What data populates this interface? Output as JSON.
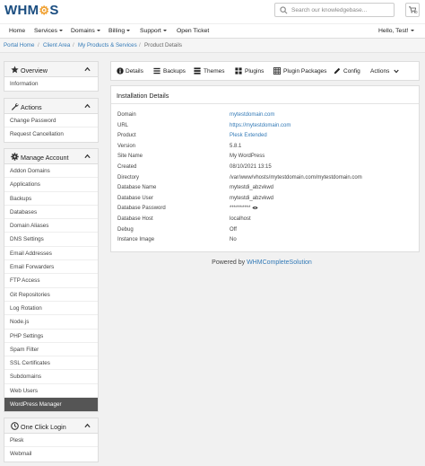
{
  "brand": {
    "logo_text": "WHM",
    "logo_gear": "⚙",
    "logo_tail": "S",
    "accent": "#337ab7",
    "dark_nav": "#555555"
  },
  "header": {
    "search_placeholder": "Search our knowledgebase...",
    "cart_count": "0"
  },
  "nav": {
    "items": [
      {
        "label": "Home",
        "dropdown": false
      },
      {
        "label": "Services",
        "dropdown": true
      },
      {
        "label": "Domains",
        "dropdown": true
      },
      {
        "label": "Billing",
        "dropdown": true
      },
      {
        "label": "Support",
        "dropdown": true
      },
      {
        "label": "Open Ticket",
        "dropdown": false
      }
    ],
    "user": "Hello, Test!"
  },
  "breadcrumb": [
    "Portal Home",
    "Client Area",
    "My Products & Services",
    "Product Details"
  ],
  "sidebar": {
    "overview": {
      "title": "Overview",
      "icon": "star-icon",
      "items": [
        "Information"
      ]
    },
    "actions": {
      "title": "Actions",
      "icon": "wrench-icon",
      "items": [
        "Change Password",
        "Request Cancellation"
      ]
    },
    "manage": {
      "title": "Manage Account",
      "icon": "gear-icon",
      "items": [
        "Addon Domains",
        "Applications",
        "Backups",
        "Databases",
        "Domain Aliases",
        "DNS Settings",
        "Email Addresses",
        "Email Forwarders",
        "FTP Access",
        "Git Repositories",
        "Log Rotation",
        "Node.js",
        "PHP Settings",
        "Spam Filter",
        "SSL Certificates",
        "Subdomains",
        "Web Users",
        "WordPress Manager"
      ],
      "active": "WordPress Manager"
    },
    "one_click": {
      "title": "One Click Login",
      "icon": "clock-icon",
      "items": [
        "Plesk",
        "Webmail"
      ]
    }
  },
  "tabs": [
    {
      "label": "Details",
      "icon": "info-icon"
    },
    {
      "label": "Backups",
      "icon": "list-icon"
    },
    {
      "label": "Themes",
      "icon": "themes-icon"
    },
    {
      "label": "Plugins",
      "icon": "plugin-icon"
    },
    {
      "label": "Plugin Packages",
      "icon": "table-icon"
    },
    {
      "label": "Config",
      "icon": "pencil-icon"
    },
    {
      "label": "Actions",
      "icon": "chevron-down-icon"
    }
  ],
  "details": {
    "title": "Installation Details",
    "rows": [
      {
        "key": "Domain",
        "value": "mytestdomain.com",
        "link": true
      },
      {
        "key": "URL",
        "value": "https://mytestdomain.com",
        "link": true
      },
      {
        "key": "Product",
        "value": "Plesk Extended",
        "link": true
      },
      {
        "key": "Version",
        "value": "5.8.1",
        "link": false
      },
      {
        "key": "Site Name",
        "value": "My WordPress",
        "link": false
      },
      {
        "key": "Created",
        "value": "08/10/2021 13:15",
        "link": false
      },
      {
        "key": "Directory",
        "value": "/var/www/vhosts/mytestdomain.com/mytestdomain.com",
        "link": false
      },
      {
        "key": "Database Name",
        "value": "mytestdi_abzvkwd",
        "link": false
      },
      {
        "key": "Database User",
        "value": "mytestdi_abzvkwd",
        "link": false
      },
      {
        "key": "Database Password",
        "value": "**********",
        "link": false
      },
      {
        "key": "Database Host",
        "value": "localhost",
        "link": false
      },
      {
        "key": "Debug",
        "value": "Off",
        "link": false
      },
      {
        "key": "Instance Image",
        "value": "No",
        "link": false
      }
    ]
  },
  "footer": {
    "prefix": "Powered by",
    "link": "WHMCompleteSolution"
  }
}
